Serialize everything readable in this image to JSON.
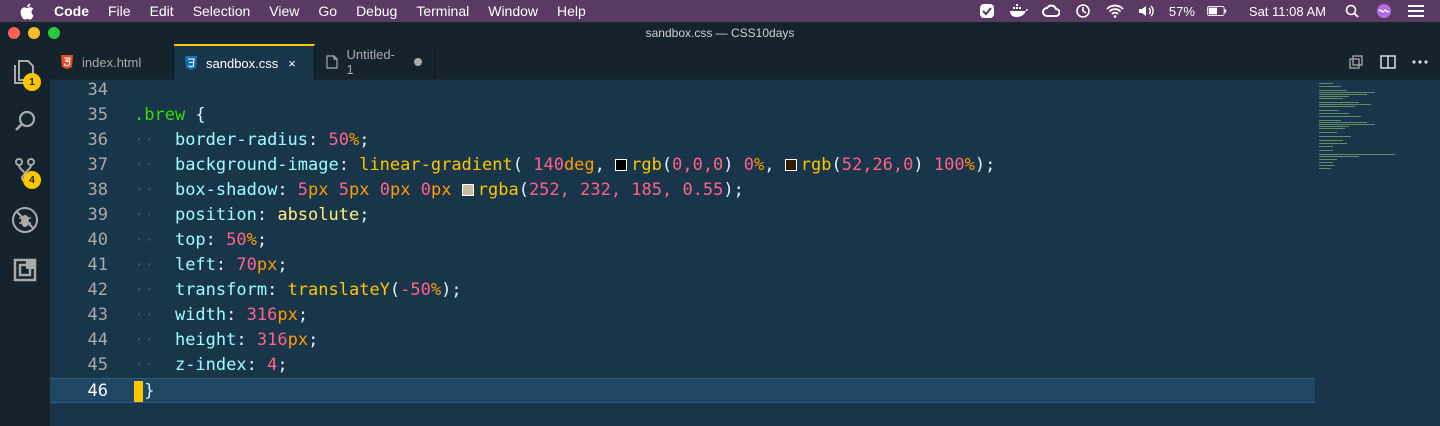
{
  "menubar": {
    "items": [
      "Code",
      "File",
      "Edit",
      "Selection",
      "View",
      "Go",
      "Debug",
      "Terminal",
      "Window",
      "Help"
    ],
    "battery": "57%",
    "clock": "Sat 11:08 AM",
    "icons": [
      "apple-icon",
      "messages-icon",
      "docker-icon",
      "creative-cloud-icon",
      "time-machine-icon",
      "wifi-icon",
      "volume-icon",
      "battery-icon",
      "spotlight-icon",
      "siri-icon",
      "control-center-icon"
    ]
  },
  "window": {
    "title": "sandbox.css — CSS10days"
  },
  "activitybar": {
    "explorer_badge": "1",
    "scm_badge": "4"
  },
  "tabs": [
    {
      "label": "index.html",
      "icon": "html5-icon",
      "active": false
    },
    {
      "label": "sandbox.css",
      "icon": "css3-icon",
      "active": true,
      "close": "×"
    },
    {
      "label": "Untitled-1",
      "icon": "file-icon",
      "active": false,
      "dirty": true
    }
  ],
  "editor": {
    "lines": [
      {
        "n": "34"
      },
      {
        "n": "35"
      },
      {
        "n": "36"
      },
      {
        "n": "37"
      },
      {
        "n": "38"
      },
      {
        "n": "39"
      },
      {
        "n": "40"
      },
      {
        "n": "41"
      },
      {
        "n": "42"
      },
      {
        "n": "43"
      },
      {
        "n": "44"
      },
      {
        "n": "45"
      },
      {
        "n": "46"
      }
    ],
    "selector": ".brew",
    "decls": {
      "border_radius": {
        "prop": "border-radius",
        "num": "50",
        "unit": "%"
      },
      "bg_image": {
        "prop": "background-image",
        "fn": "linear-gradient",
        "angle": "140",
        "angle_unit": "deg",
        "rgb1_fn": "rgb",
        "rgb1": "0,0,0",
        "stop1": "0",
        "stop1_unit": "%",
        "rgb2_fn": "rgb",
        "rgb2": "52,26,0",
        "stop2": "100",
        "stop2_unit": "%"
      },
      "box_shadow": {
        "prop": "box-shadow",
        "v1": "5",
        "v2": "5",
        "v3": "0",
        "v4": "0",
        "unit": "px",
        "fn": "rgba",
        "args": "252, 232, 185, 0.55"
      },
      "position": {
        "prop": "position",
        "val": "absolute"
      },
      "top": {
        "prop": "top",
        "num": "50",
        "unit": "%"
      },
      "left": {
        "prop": "left",
        "num": "70",
        "unit": "px"
      },
      "transform": {
        "prop": "transform",
        "fn": "translateY",
        "num": "-50",
        "unit": "%"
      },
      "width": {
        "prop": "width",
        "num": "316",
        "unit": "px"
      },
      "height": {
        "prop": "height",
        "num": "316",
        "unit": "px"
      },
      "z_index": {
        "prop": "z-index",
        "num": "4"
      }
    },
    "swatch_colors": {
      "black": "#000000",
      "brown": "#341a00",
      "cream": "#fce8b9"
    }
  },
  "colors": {
    "accent": "#ffc600",
    "background": "#193549"
  }
}
